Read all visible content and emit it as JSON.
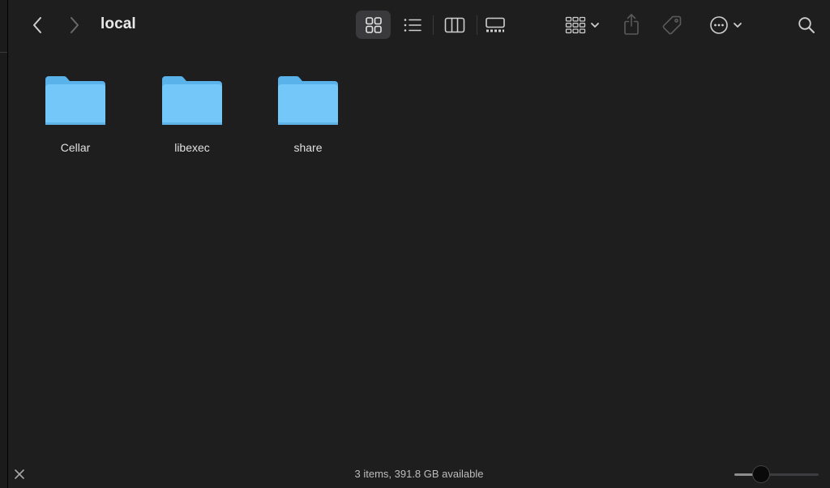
{
  "window": {
    "title": "local"
  },
  "toolbar": {
    "back_icon": "chevron-left-icon",
    "forward_icon": "chevron-right-icon",
    "views": [
      {
        "name": "icon-view",
        "icon": "grid-icon",
        "selected": true
      },
      {
        "name": "list-view",
        "icon": "list-icon",
        "selected": false
      },
      {
        "name": "column-view",
        "icon": "columns-icon",
        "selected": false
      },
      {
        "name": "gallery-view",
        "icon": "gallery-icon",
        "selected": false
      }
    ],
    "group_icon": "group-icon",
    "share_icon": "share-icon",
    "tag_icon": "tag-icon",
    "more_icon": "ellipsis-circle-icon",
    "search_icon": "magnifier-icon"
  },
  "items": [
    {
      "name": "Cellar",
      "type": "folder"
    },
    {
      "name": "libexec",
      "type": "folder"
    },
    {
      "name": "share",
      "type": "folder"
    }
  ],
  "status": {
    "text": "3 items, 391.8 GB available",
    "zoom_level": 0.27
  },
  "colors": {
    "background": "#1e1e1f",
    "folder_body": "#6ec6f8",
    "folder_tab": "#5ab2ea",
    "selected_view_bg": "#3a3a3c"
  }
}
